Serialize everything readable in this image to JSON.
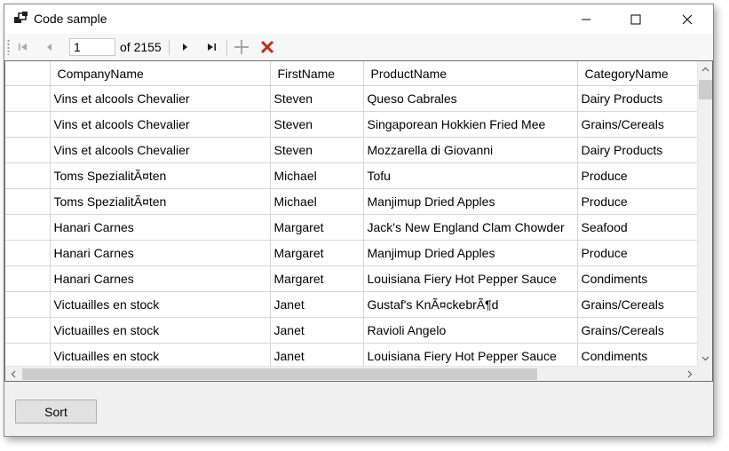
{
  "window": {
    "title": "Code sample"
  },
  "toolbar": {
    "position_value": "1",
    "count_label": "of 2155"
  },
  "grid": {
    "columns": [
      "CompanyName",
      "FirstName",
      "ProductName",
      "CategoryName"
    ],
    "rows": [
      [
        "Vins et alcools Chevalier",
        "Steven",
        "Queso Cabrales",
        "Dairy Products"
      ],
      [
        "Vins et alcools Chevalier",
        "Steven",
        "Singaporean Hokkien Fried Mee",
        "Grains/Cereals"
      ],
      [
        "Vins et alcools Chevalier",
        "Steven",
        "Mozzarella di Giovanni",
        "Dairy Products"
      ],
      [
        "Toms SpezialitÃ¤ten",
        "Michael",
        "Tofu",
        "Produce"
      ],
      [
        "Toms SpezialitÃ¤ten",
        "Michael",
        "Manjimup Dried Apples",
        "Produce"
      ],
      [
        "Hanari Carnes",
        "Margaret",
        "Jack's New England Clam Chowder",
        "Seafood"
      ],
      [
        "Hanari Carnes",
        "Margaret",
        "Manjimup Dried Apples",
        "Produce"
      ],
      [
        "Hanari Carnes",
        "Margaret",
        "Louisiana Fiery Hot Pepper Sauce",
        "Condiments"
      ],
      [
        "Victuailles en stock",
        "Janet",
        "Gustaf's KnÃ¤ckebrÃ¶d",
        "Grains/Cereals"
      ],
      [
        "Victuailles en stock",
        "Janet",
        "Ravioli Angelo",
        "Grains/Cereals"
      ],
      [
        "Victuailles en stock",
        "Janet",
        "Louisiana Fiery Hot Pepper Sauce",
        "Condiments"
      ]
    ]
  },
  "footer": {
    "sort_label": "Sort"
  },
  "icons": {
    "app": "app-icon",
    "first": "move-first-icon",
    "previous": "move-previous-icon",
    "next": "move-next-icon",
    "last": "move-last-icon",
    "add": "add-new-icon",
    "delete": "delete-icon"
  },
  "colors": {
    "delete_icon": "#c42b1c",
    "add_icon_disabled": "#a6a6a6",
    "nav_icon_disabled": "#a8a8a8",
    "nav_icon_enabled": "#1e1e1e"
  }
}
